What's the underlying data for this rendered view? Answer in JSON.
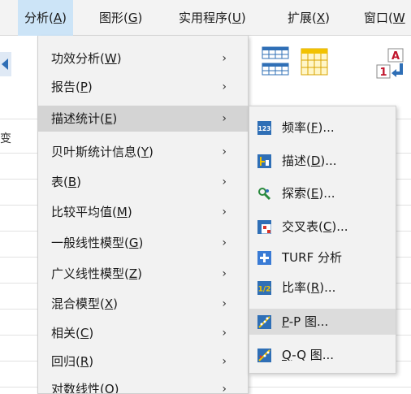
{
  "menubar": {
    "items": [
      {
        "label": "分析(",
        "key": "A",
        "tail": ")"
      },
      {
        "label": "图形(",
        "key": "G",
        "tail": ")"
      },
      {
        "label": "实用程序(",
        "key": "U",
        "tail": ")"
      },
      {
        "label": "扩展(",
        "key": "X",
        "tail": ")"
      },
      {
        "label": "窗口(",
        "key": "W",
        "tail": ""
      }
    ]
  },
  "background": {
    "column_label": "变"
  },
  "main_menu": {
    "arrow": "›",
    "items": [
      {
        "label": "功效分析(",
        "key": "W",
        "tail": ")"
      },
      {
        "label": "报告(",
        "key": "P",
        "tail": ")"
      },
      {
        "label": "描述统计(",
        "key": "E",
        "tail": ")"
      },
      {
        "label": "贝叶斯统计信息(",
        "key": "Y",
        "tail": ")"
      },
      {
        "label": "表(",
        "key": "B",
        "tail": ")"
      },
      {
        "label": "比较平均值(",
        "key": "M",
        "tail": ")"
      },
      {
        "label": "一般线性模型(",
        "key": "G",
        "tail": ")"
      },
      {
        "label": "广义线性模型(",
        "key": "Z",
        "tail": ")"
      },
      {
        "label": "混合模型(",
        "key": "X",
        "tail": ")"
      },
      {
        "label": "相关(",
        "key": "C",
        "tail": ")"
      },
      {
        "label": "回归(",
        "key": "R",
        "tail": ")"
      },
      {
        "label": "对数线性(",
        "key": "O",
        "tail": ")"
      }
    ]
  },
  "sub_menu": {
    "items": [
      {
        "pre": "频率(",
        "key": "F",
        "tail": ")...",
        "icon": "frequencies-icon"
      },
      {
        "pre": "描述(",
        "key": "D",
        "tail": ")...",
        "icon": "descriptives-icon"
      },
      {
        "pre": "探索(",
        "key": "E",
        "tail": ")...",
        "icon": "explore-icon"
      },
      {
        "pre": "交叉表(",
        "key": "C",
        "tail": ")...",
        "icon": "crosstabs-icon"
      },
      {
        "pre": "TURF 分析",
        "key": "",
        "tail": "",
        "icon": "turf-icon"
      },
      {
        "pre": "比率(",
        "key": "R",
        "tail": ")...",
        "icon": "ratio-icon"
      },
      {
        "pre": "",
        "key": "P",
        "tail": "-P 图...",
        "icon": "pp-plot-icon"
      },
      {
        "pre": "",
        "key": "Q",
        "tail": "-Q 图...",
        "icon": "qq-plot-icon"
      }
    ]
  },
  "colors": {
    "menu_bg": "#f2f2f2",
    "highlight": "#d4d4d4",
    "menubar_active": "#cce4f7",
    "icon_blue": "#2f6fb6"
  }
}
